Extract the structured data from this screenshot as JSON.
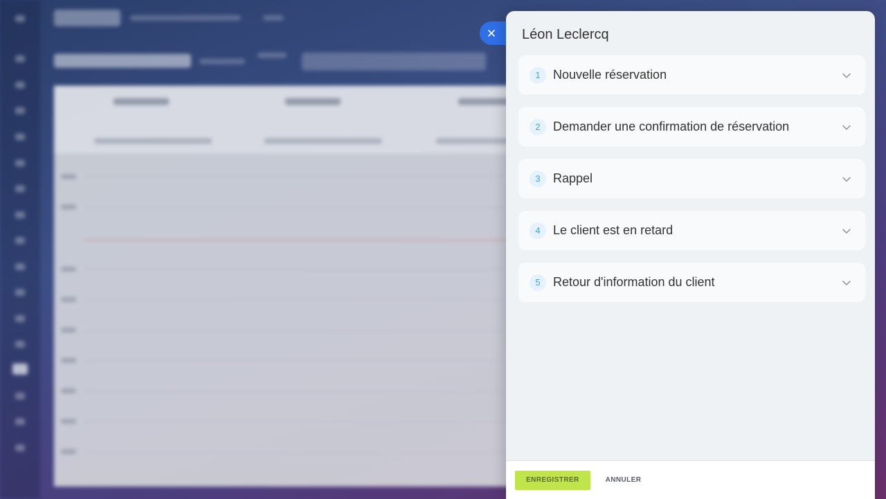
{
  "panel": {
    "title": "Léon Leclercq",
    "steps": [
      {
        "number": "1",
        "label": "Nouvelle réservation"
      },
      {
        "number": "2",
        "label": "Demander une confirmation de réservation"
      },
      {
        "number": "3",
        "label": "Rappel"
      },
      {
        "number": "4",
        "label": "Le client est en retard"
      },
      {
        "number": "5",
        "label": "Retour d'information du client"
      }
    ],
    "footer": {
      "save_label": "ENREGISTRER",
      "cancel_label": "ANNULER"
    }
  },
  "colors": {
    "accent_close": "#2f6fe8",
    "save_button": "#bfe54a",
    "step_number": "#4aa3df"
  },
  "icons": {
    "close": "close-icon",
    "chevron": "chevron-down-icon"
  }
}
